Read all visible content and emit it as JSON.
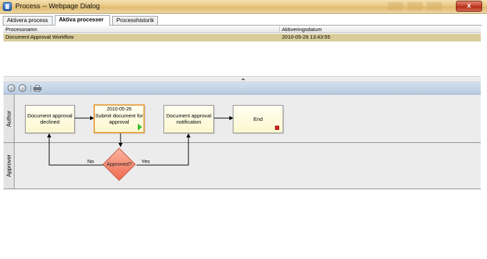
{
  "window": {
    "title": "Process -- Webpage Dialog",
    "close_label": "x"
  },
  "tabs": [
    {
      "label": "Aktivera process"
    },
    {
      "label": "Aktiva processer"
    },
    {
      "label": "Processhistorik"
    }
  ],
  "process_list": {
    "columns": [
      "Processnamn",
      "Aktiveringsdatum"
    ],
    "rows": [
      {
        "name": "Document Approval Workflow",
        "date": "2010-05-26 13:43:55"
      }
    ]
  },
  "toolbar": {
    "back_icon": "back-icon",
    "forward_icon": "forward-icon",
    "print_icon": "print-icon"
  },
  "diagram": {
    "lanes": [
      "Author",
      "Approver"
    ],
    "nodes": {
      "declined": "Document approval declined",
      "submit_date": "2010-05-26",
      "submit": "Submit document for approval",
      "notification": "Document approval notification",
      "end": "End",
      "decision": "Approved?"
    },
    "edge_labels": {
      "no": "No",
      "yes": "Yes"
    }
  },
  "colors": {
    "selected_row": "#d8cc98",
    "current_step_border": "#e5a44a",
    "decision_fill": "#ef6a4e",
    "toolbar": "#c6d6e8"
  }
}
